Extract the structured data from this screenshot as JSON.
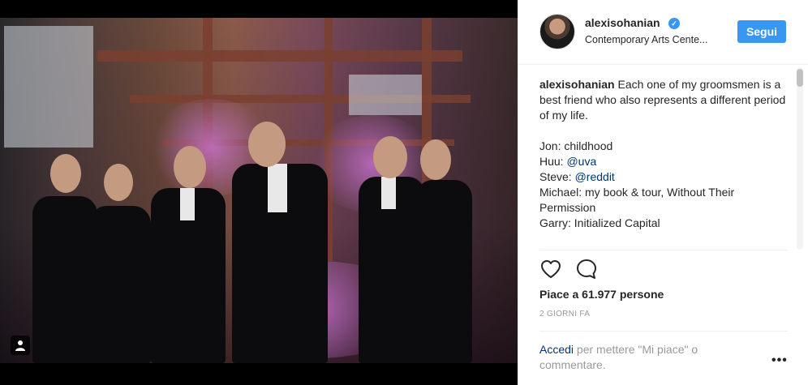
{
  "post": {
    "username": "alexisohanian",
    "verified_icon": "verified-badge-icon",
    "location": "Contemporary Arts Cente...",
    "follow_label": "Segui",
    "caption_intro": "Each one of my groomsmen is a best friend who also represents a different period of my life.",
    "caption_lines": [
      {
        "text": "Jon: childhood"
      },
      {
        "prefix": "Huu: ",
        "mention": "@uva"
      },
      {
        "prefix": "Steve: ",
        "mention": "@reddit"
      },
      {
        "text": "Michael: my book & tour, Without Their Permission"
      },
      {
        "text": "Garry: Initialized Capital"
      }
    ],
    "likes": "Piace a 61.977 persone",
    "timestamp": "2 GIORNI FA",
    "login_link": "Accedi",
    "login_rest": " per mettere \"Mi piace\" o commentare.",
    "more_label": "•••"
  },
  "icons": {
    "like": "heart-icon",
    "comment": "comment-bubble-icon",
    "tag": "user-tag-icon"
  },
  "colors": {
    "accent": "#3897f0",
    "link": "#003569",
    "muted": "#999999",
    "text": "#262626"
  }
}
